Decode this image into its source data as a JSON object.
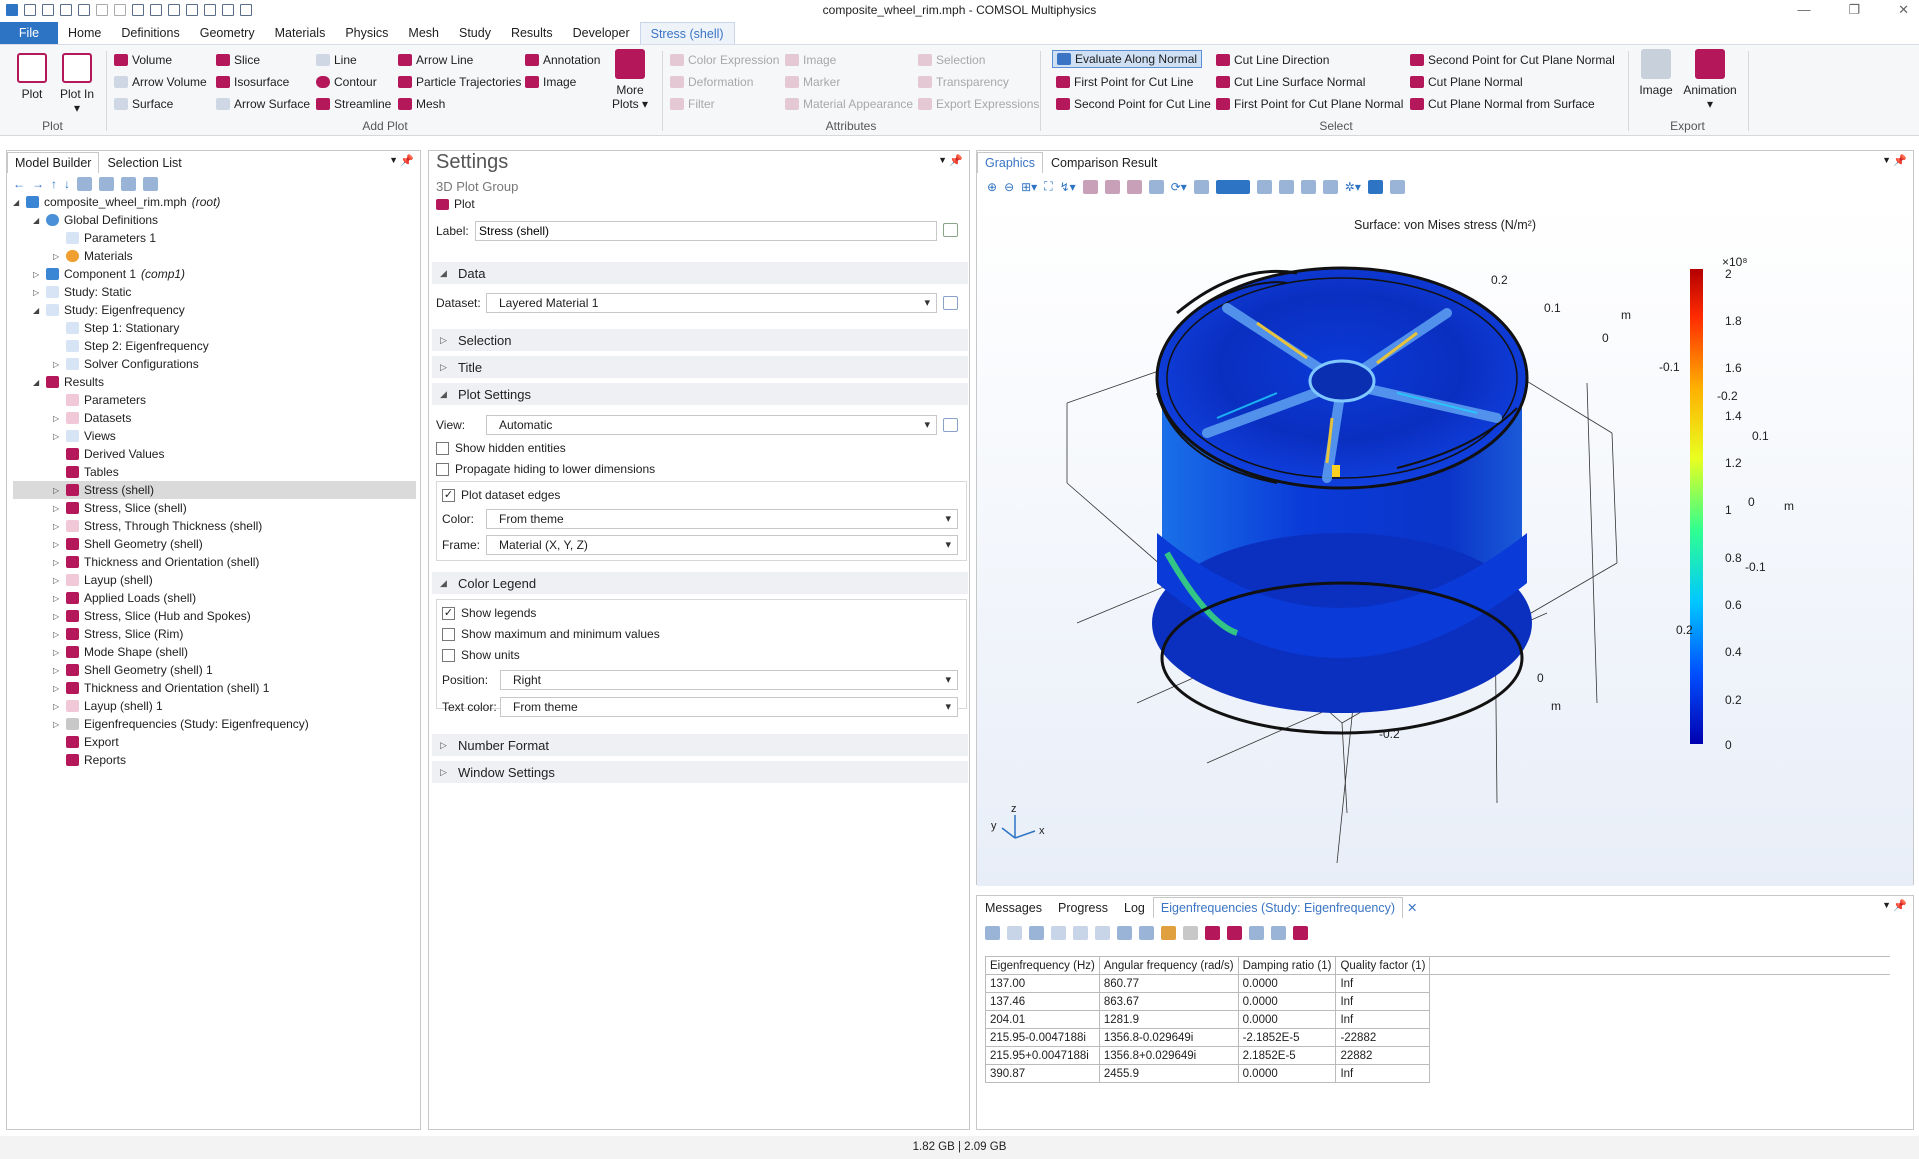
{
  "window": {
    "title": "composite_wheel_rim.mph - COMSOL Multiphysics"
  },
  "ribbon_tabs": [
    "File",
    "Home",
    "Definitions",
    "Geometry",
    "Materials",
    "Physics",
    "Mesh",
    "Study",
    "Results",
    "Developer",
    "Stress (shell)"
  ],
  "ribbon": {
    "plot_group": {
      "plot": "Plot",
      "plot_in": "Plot In",
      "label": "Plot"
    },
    "add_plot": {
      "items": [
        "Volume",
        "Arrow Volume",
        "Surface",
        "Slice",
        "Isosurface",
        "Arrow Surface",
        "Line",
        "Contour",
        "Streamline",
        "Arrow Line",
        "Particle Trajectories",
        "Mesh",
        "Annotation",
        "Image"
      ],
      "more_plots": "More Plots",
      "label": "Add Plot"
    },
    "attributes": {
      "items": [
        "Color Expression",
        "Deformation",
        "Filter",
        "Image",
        "Marker",
        "Material Appearance",
        "Selection",
        "Transparency",
        "Export Expressions"
      ],
      "label": "Attributes"
    },
    "select": {
      "items": [
        "Evaluate Along Normal",
        "First Point for Cut Line",
        "Second Point for Cut Line",
        "Cut Line Direction",
        "Cut Line Surface Normal",
        "First Point for Cut Plane Normal",
        "Second Point for Cut Plane Normal",
        "Cut Plane Normal",
        "Cut Plane Normal from Surface"
      ],
      "label": "Select"
    },
    "export": {
      "image": "Image",
      "animation": "Animation",
      "label": "Export"
    }
  },
  "model_builder": {
    "tabs": [
      "Model Builder",
      "Selection List"
    ],
    "tree": [
      {
        "label": "composite_wheel_rim.mph",
        "suffix": "(root)"
      },
      {
        "label": "Global Definitions"
      },
      {
        "label": "Parameters 1"
      },
      {
        "label": "Materials"
      },
      {
        "label": "Component 1",
        "suffix": "(comp1)"
      },
      {
        "label": "Study: Static"
      },
      {
        "label": "Study: Eigenfrequency"
      },
      {
        "label": "Step 1: Stationary"
      },
      {
        "label": "Step 2: Eigenfrequency"
      },
      {
        "label": "Solver Configurations"
      },
      {
        "label": "Results"
      },
      {
        "label": "Parameters"
      },
      {
        "label": "Datasets"
      },
      {
        "label": "Views"
      },
      {
        "label": "Derived Values"
      },
      {
        "label": "Tables"
      },
      {
        "label": "Stress (shell)"
      },
      {
        "label": "Stress, Slice (shell)"
      },
      {
        "label": "Stress, Through Thickness (shell)"
      },
      {
        "label": "Shell Geometry (shell)"
      },
      {
        "label": "Thickness and Orientation (shell)"
      },
      {
        "label": "Layup (shell)"
      },
      {
        "label": "Applied Loads (shell)"
      },
      {
        "label": "Stress, Slice (Hub and Spokes)"
      },
      {
        "label": "Stress, Slice (Rim)"
      },
      {
        "label": "Mode Shape (shell)"
      },
      {
        "label": "Shell Geometry (shell) 1"
      },
      {
        "label": "Thickness and Orientation (shell) 1"
      },
      {
        "label": "Layup (shell) 1"
      },
      {
        "label": "Eigenfrequencies (Study: Eigenfrequency)"
      },
      {
        "label": "Export"
      },
      {
        "label": "Reports"
      }
    ]
  },
  "settings": {
    "title": "Settings",
    "subtitle": "3D Plot Group",
    "plot_button": "Plot",
    "label_caption": "Label:",
    "label_value": "Stress (shell)",
    "sections": {
      "data": "Data",
      "selection": "Selection",
      "title": "Title",
      "plot_settings": "Plot Settings",
      "color_legend": "Color Legend",
      "number_format": "Number Format",
      "window_settings": "Window Settings"
    },
    "dataset_caption": "Dataset:",
    "dataset_value": "Layered Material 1",
    "view_caption": "View:",
    "view_value": "Automatic",
    "show_hidden": "Show hidden entities",
    "propagate": "Propagate hiding to lower dimensions",
    "plot_edges": "Plot dataset edges",
    "color_caption": "Color:",
    "color_value": "From theme",
    "frame_caption": "Frame:",
    "frame_value": "Material  (X, Y, Z)",
    "show_legends": "Show legends",
    "show_maxmin": "Show maximum and minimum values",
    "show_units": "Show units",
    "position_caption": "Position:",
    "position_value": "Right",
    "textcolor_caption": "Text color:",
    "textcolor_value": "From theme"
  },
  "graphics": {
    "tabs": [
      "Graphics",
      "Comparison Result"
    ],
    "plot_title": "Surface: von Mises stress (N/m²)",
    "colorbar": {
      "multiplier": "×10⁸",
      "ticks": [
        "2",
        "1.8",
        "1.6",
        "1.4",
        "1.2",
        "1",
        "0.8",
        "0.6",
        "0.4",
        "0.2",
        "0"
      ]
    },
    "axis_labels": [
      "0.2",
      "0.1",
      "0",
      "-0.1",
      "-0.2",
      "0.1",
      "0",
      "-0.1",
      "0.2",
      "0",
      "-0.2",
      "m",
      "m",
      "m"
    ],
    "triad": [
      "z",
      "y",
      "x"
    ]
  },
  "messages": {
    "tabs": [
      "Messages",
      "Progress",
      "Log",
      "Eigenfrequencies (Study: Eigenfrequency)"
    ],
    "columns": [
      "Eigenfrequency (Hz)",
      "Angular frequency (rad/s)",
      "Damping ratio (1)",
      "Quality factor (1)"
    ],
    "rows": [
      [
        "137.00",
        "860.77",
        "0.0000",
        "Inf"
      ],
      [
        "137.46",
        "863.67",
        "0.0000",
        "Inf"
      ],
      [
        "204.01",
        "1281.9",
        "0.0000",
        "Inf"
      ],
      [
        "215.95-0.0047188i",
        "1356.8-0.029649i",
        "-2.1852E-5",
        "-22882"
      ],
      [
        "215.95+0.0047188i",
        "1356.8+0.029649i",
        "2.1852E-5",
        "22882"
      ],
      [
        "390.87",
        "2455.9",
        "0.0000",
        "Inf"
      ]
    ]
  },
  "status": {
    "memory": "1.82 GB | 2.09 GB"
  },
  "colors": {
    "accent": "#2e74c4",
    "results_icon": "#b4185a",
    "selected_row": "#dadada"
  }
}
